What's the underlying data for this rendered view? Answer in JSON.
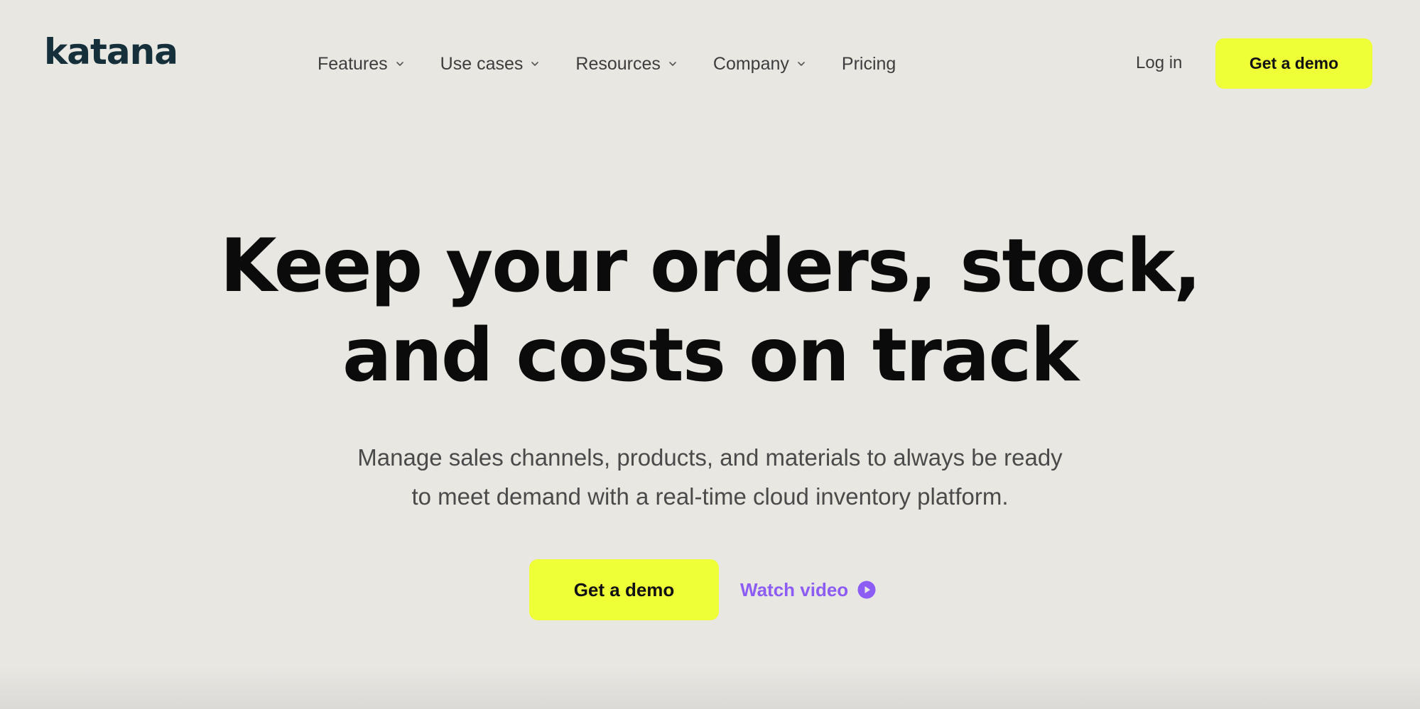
{
  "brand": {
    "logo_text": "katana"
  },
  "nav": {
    "items": [
      {
        "label": "Features",
        "has_dropdown": true
      },
      {
        "label": "Use cases",
        "has_dropdown": true
      },
      {
        "label": "Resources",
        "has_dropdown": true
      },
      {
        "label": "Company",
        "has_dropdown": true
      },
      {
        "label": "Pricing",
        "has_dropdown": false
      }
    ],
    "login_label": "Log in",
    "demo_label": "Get a demo"
  },
  "hero": {
    "title_line1": "Keep your orders, stock,",
    "title_line2": "and costs on track",
    "subtitle_line1": "Manage sales channels, products, and materials to always be ready",
    "subtitle_line2": "to meet demand with a real-time cloud inventory platform.",
    "primary_cta": "Get a demo",
    "secondary_cta": "Watch video"
  },
  "icons": {
    "dropdown": "chevron-down-icon",
    "play": "play-circle-icon"
  },
  "colors": {
    "background": "#e9e7e2",
    "accent": "#eeff38",
    "link": "#8c5cf5",
    "logo": "#15303a"
  }
}
